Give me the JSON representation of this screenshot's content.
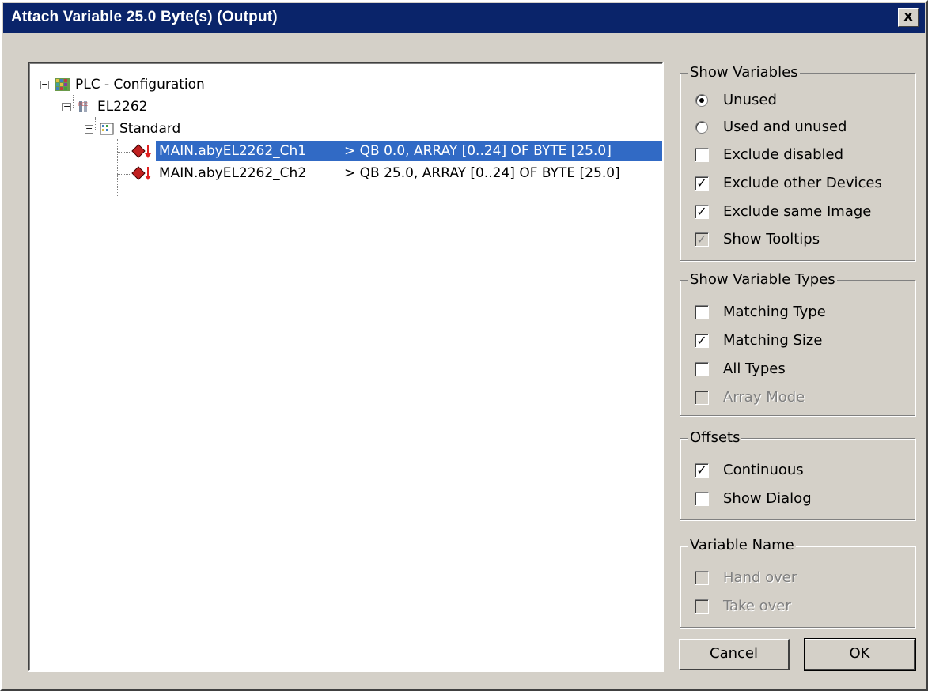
{
  "window": {
    "title": "Attach Variable 25.0 Byte(s) (Output)",
    "close_glyph": "x"
  },
  "tree": {
    "root": {
      "label": "PLC - Configuration",
      "icon": "plc-config-icon",
      "expanded": true
    },
    "device": {
      "label": "EL2262",
      "icon": "device-icon",
      "expanded": true
    },
    "group": {
      "label": "Standard",
      "icon": "folder-icon",
      "expanded": true
    },
    "variables": [
      {
        "name": "MAIN.abyEL2262_Ch1",
        "info": "> QB 0.0, ARRAY [0..24] OF BYTE [25.0]",
        "icon": "output-variable-icon",
        "selected": true
      },
      {
        "name": "MAIN.abyEL2262_Ch2",
        "info": "> QB 25.0, ARRAY [0..24] OF BYTE [25.0]",
        "icon": "output-variable-icon",
        "selected": false
      }
    ]
  },
  "show_variables": {
    "label": "Show Variables",
    "options": [
      {
        "type": "radio",
        "label": "Unused",
        "checked": true,
        "enabled": true
      },
      {
        "type": "radio",
        "label": "Used and unused",
        "checked": false,
        "enabled": true
      },
      {
        "type": "checkbox",
        "label": "Exclude disabled",
        "checked": false,
        "enabled": true
      },
      {
        "type": "checkbox",
        "label": "Exclude other Devices",
        "checked": true,
        "enabled": true
      },
      {
        "type": "checkbox",
        "label": "Exclude same Image",
        "checked": true,
        "enabled": true
      },
      {
        "type": "checkbox",
        "label": "Show Tooltips",
        "checked": true,
        "enabled": false
      }
    ]
  },
  "show_variable_types": {
    "label": "Show Variable Types",
    "options": [
      {
        "type": "checkbox",
        "label": "Matching Type",
        "checked": false,
        "enabled": true
      },
      {
        "type": "checkbox",
        "label": "Matching Size",
        "checked": true,
        "enabled": true
      },
      {
        "type": "checkbox",
        "label": "All Types",
        "checked": false,
        "enabled": true
      },
      {
        "type": "checkbox",
        "label": "Array Mode",
        "checked": false,
        "enabled": false
      }
    ]
  },
  "offsets": {
    "label": "Offsets",
    "options": [
      {
        "type": "checkbox",
        "label": "Continuous",
        "checked": true,
        "enabled": true
      },
      {
        "type": "checkbox",
        "label": "Show Dialog",
        "checked": false,
        "enabled": true
      }
    ]
  },
  "variable_name": {
    "label": "Variable Name",
    "options": [
      {
        "type": "checkbox",
        "label": "Hand over",
        "checked": false,
        "enabled": false
      },
      {
        "type": "checkbox",
        "label": "Take over",
        "checked": false,
        "enabled": false
      }
    ]
  },
  "buttons": {
    "cancel": "Cancel",
    "ok": "OK"
  },
  "colors": {
    "titlebar": "#0a246a",
    "dialog_bg": "#d4d0c8",
    "selection": "#316ac5"
  }
}
